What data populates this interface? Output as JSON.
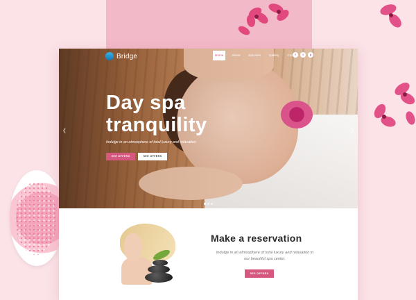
{
  "brand": {
    "name": "Bridge",
    "accent": "#d6587f",
    "logo_color": "#2a9ad6"
  },
  "nav": {
    "items": [
      {
        "label": "Home",
        "active": true
      },
      {
        "label": "About",
        "active": false
      },
      {
        "label": "Services",
        "active": false
      },
      {
        "label": "Gallery",
        "active": false
      },
      {
        "label": "Contact",
        "active": false
      }
    ],
    "socials": [
      "facebook-icon",
      "twitter-icon",
      "pinterest-icon"
    ]
  },
  "hero": {
    "title_line1": "Day spa",
    "title_line2": "tranquility",
    "subtitle": "Indulge in an atmosphere of total luxury and relaxation",
    "button_primary": "SEE OFFERS",
    "button_secondary": "SEE OFFERS",
    "slides_count": 3
  },
  "reservation": {
    "title": "Make a reservation",
    "text": "Indulge in an atmosphere of total luxury and relaxation in our beautiful spa center.",
    "button": "SEE OFFERS"
  }
}
